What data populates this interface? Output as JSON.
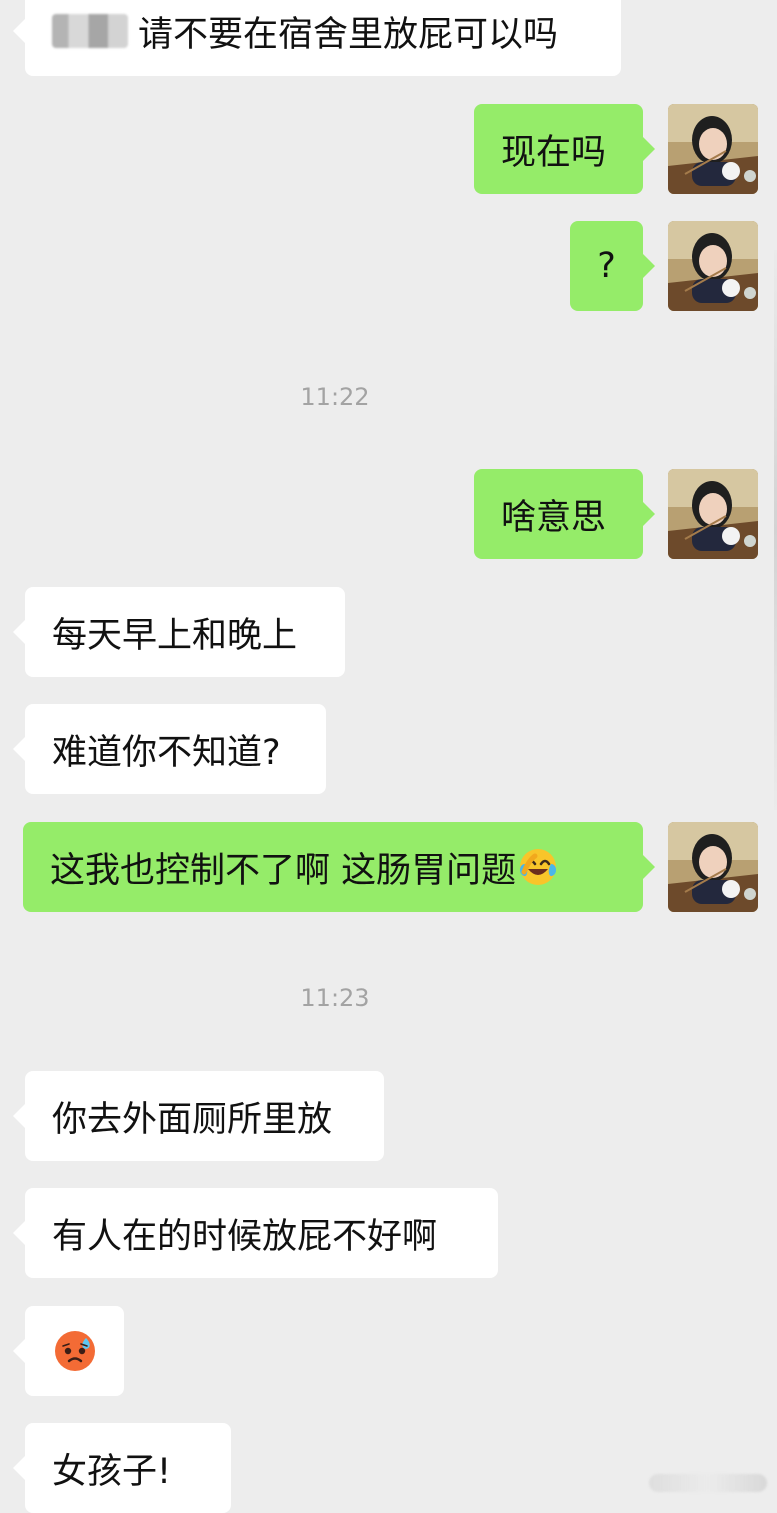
{
  "conversation": {
    "messages": [
      {
        "side": "left",
        "text": "请不要在宿舍里放屁可以吗",
        "has_blurred_name": true
      },
      {
        "side": "right",
        "text": "现在吗"
      },
      {
        "side": "right",
        "text": "?"
      },
      {
        "type": "timestamp",
        "text": "11:22"
      },
      {
        "side": "right",
        "text": "啥意思"
      },
      {
        "side": "left",
        "text": "每天早上和晚上"
      },
      {
        "side": "left",
        "text": "难道你不知道?"
      },
      {
        "side": "right",
        "text": "这我也控制不了啊  这肠胃问题",
        "emoji": "crying-laughing-emoji"
      },
      {
        "type": "timestamp",
        "text": "11:23"
      },
      {
        "side": "left",
        "text": "你去外面厕所里放"
      },
      {
        "side": "left",
        "text": "有人在的时候放屁不好啊"
      },
      {
        "side": "left",
        "sticker": "sad-sweat-emoji"
      },
      {
        "side": "left",
        "text": "女孩子!"
      }
    ]
  },
  "colors": {
    "background": "#ededed",
    "outgoing_bubble": "#95ec69",
    "incoming_bubble": "#ffffff",
    "timestamp": "#a3a3a3",
    "text": "#111111"
  }
}
